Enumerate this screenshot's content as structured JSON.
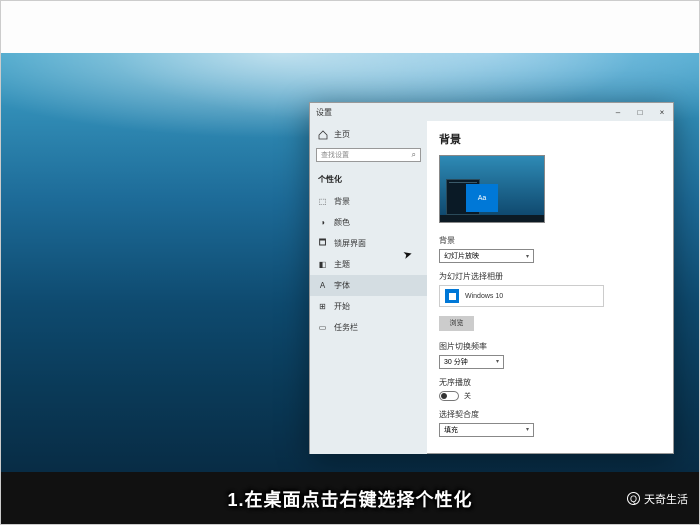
{
  "caption": "1.在桌面点击右键选择个性化",
  "watermark": {
    "icon_letter": "Q",
    "text": "天奇生活"
  },
  "window": {
    "title": "设置",
    "controls": {
      "min": "–",
      "max": "□",
      "close": "×"
    }
  },
  "sidebar": {
    "home_label": "主页",
    "search_placeholder": "查找设置",
    "category": "个性化",
    "items": [
      {
        "icon": "⬚",
        "label": "背景"
      },
      {
        "icon": "◑",
        "label": "颜色"
      },
      {
        "icon": "🗖",
        "label": "锁屏界面"
      },
      {
        "icon": "◧",
        "label": "主题"
      },
      {
        "icon": "A",
        "label": "字体"
      },
      {
        "icon": "⊞",
        "label": "开始"
      },
      {
        "icon": "▭",
        "label": "任务栏"
      }
    ],
    "active_index": 4
  },
  "content": {
    "title": "背景",
    "preview_accent_text": "Aa",
    "bg_label": "背景",
    "bg_value": "幻灯片放映",
    "album_label": "为幻灯片选择相册",
    "album_value": "Windows 10",
    "browse_btn": "浏览",
    "interval_label": "图片切换频率",
    "interval_value": "30 分钟",
    "shuffle_label": "无序播放",
    "shuffle_value_label": "关",
    "fit_label": "选择契合度",
    "fit_value": "填充"
  }
}
